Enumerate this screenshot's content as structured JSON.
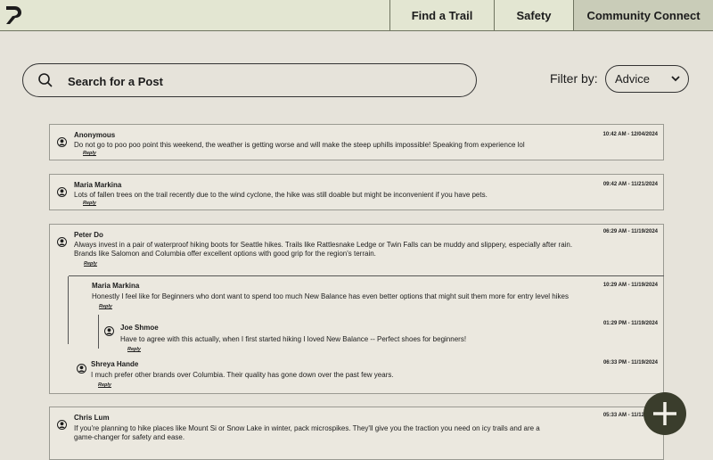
{
  "nav": {
    "logo_icon": "trail-logo-icon",
    "tabs": [
      "Find a Trail",
      "Safety",
      "Community Connect"
    ],
    "active_tab": "Community Connect"
  },
  "search": {
    "placeholder": "Search for a Post",
    "value": ""
  },
  "filter": {
    "label": "Filter by:",
    "selected": "Advice"
  },
  "reply_label": "Reply",
  "posts": [
    {
      "author": "Anonymous",
      "time": "10:42 AM - 12/04/2024",
      "text": "Do not go to poo poo point this weekend, the weather is getting worse and will make the steep uphills impossible! Speaking from experience lol"
    },
    {
      "author": "Maria Markina",
      "time": "09:42 AM - 11/21/2024",
      "text": "Lots of fallen trees on the trail recently due to the wind cyclone, the hike was still doable but might be inconvenient if you have pets."
    },
    {
      "author": "Peter Do",
      "time": "06:29 AM - 11/19/2024",
      "text_line1": "Always invest in a pair of waterproof hiking boots for Seattle hikes. Trails like Rattlesnake Ledge or Twin Falls can be muddy and slippery, especially after rain.",
      "text_line2": "Brands like Salomon and Columbia offer excellent options with good grip for the region's terrain.",
      "replies": [
        {
          "author": "Maria Markina",
          "time": "10:29 AM - 11/19/2024",
          "text": "Honestly I feel like for Beginners who dont want to spend too much New Balance has even better options that might suit them more for entry level hikes",
          "replies": [
            {
              "author": "Joe Shmoe",
              "time": "01:29 PM - 11/19/2024",
              "text": "Have to agree with this actually, when I first started hiking I loved New Balance -- Perfect shoes for beginners!"
            }
          ]
        },
        {
          "author": "Shreya Hande",
          "time": "06:33 PM - 11/19/2024",
          "text": "I much prefer other brands over Columbia. Their quality has gone down over the past few years."
        }
      ]
    },
    {
      "author": "Chris Lum",
      "time": "05:33 AM - 11/12/2024",
      "text_line1": "If you're planning to hike places like Mount Si or Snow Lake in winter, pack microspikes. They'll give you the traction you need on icy trails and are a",
      "text_line2": "game-changer for safety and ease."
    }
  ],
  "fab_icon": "plus-icon",
  "colors": {
    "nav_bg": "#e3e6d2",
    "active_tab_bg": "#c9ccb8",
    "page_bg": "#e6e3da",
    "fab_bg": "#3a3d2c"
  }
}
